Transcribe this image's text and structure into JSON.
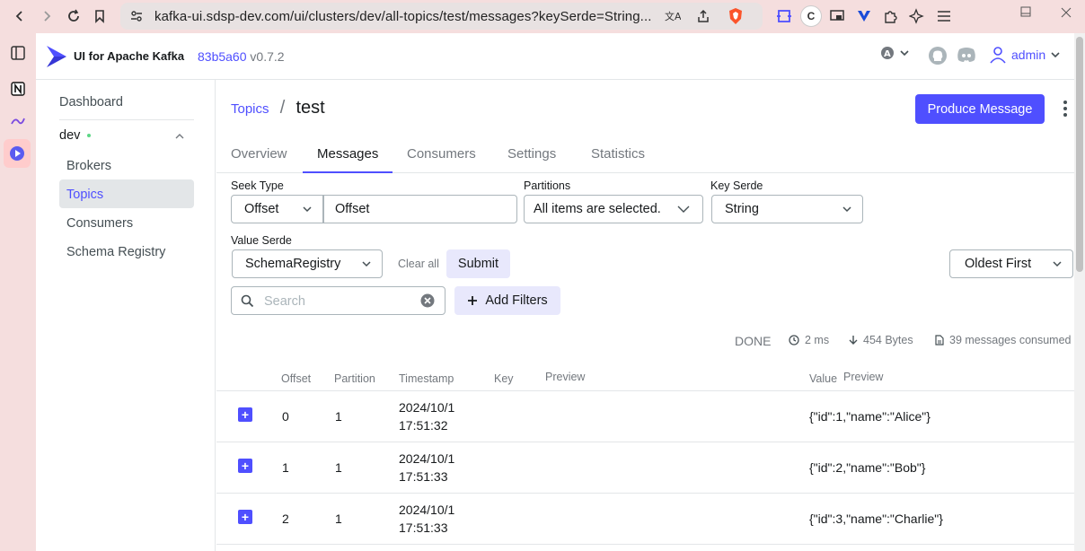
{
  "browser": {
    "url": "kafka-ui.sdsp-dev.com/ui/clusters/dev/all-topics/test/messages?keySerde=String..."
  },
  "header": {
    "brand": "UI for Apache Kafka",
    "version_hash": "83b5a60",
    "version": "v0.7.2",
    "user": "admin"
  },
  "nav": {
    "dashboard": "Dashboard",
    "cluster": "dev",
    "items": [
      "Brokers",
      "Topics",
      "Consumers",
      "Schema Registry"
    ]
  },
  "page": {
    "breadcrumb_link": "Topics",
    "title": "test",
    "produce_button": "Produce Message"
  },
  "tabs": [
    "Overview",
    "Messages",
    "Consumers",
    "Settings",
    "Statistics"
  ],
  "filters": {
    "seek_type_label": "Seek Type",
    "seek_type_value": "Offset",
    "offset_value": "Offset",
    "partitions_label": "Partitions",
    "partitions_value": "All items are selected.",
    "key_serde_label": "Key Serde",
    "key_serde_value": "String",
    "value_serde_label": "Value Serde",
    "value_serde_value": "SchemaRegistry",
    "clear_all": "Clear all",
    "submit": "Submit",
    "sort": "Oldest First",
    "search_placeholder": "Search",
    "add_filters": "Add Filters"
  },
  "stats": {
    "status": "DONE",
    "elapsed": "2 ms",
    "bytes": "454 Bytes",
    "consumed": "39 messages consumed"
  },
  "table": {
    "headers": {
      "offset": "Offset",
      "partition": "Partition",
      "timestamp": "Timestamp",
      "key": "Key",
      "key_preview": "Preview",
      "value": "Value",
      "value_preview": "Preview"
    },
    "rows": [
      {
        "offset": "0",
        "partition": "1",
        "date": "2024/10/1",
        "time": "17:51:32",
        "value": "{\"id\":1,\"name\":\"Alice\"}"
      },
      {
        "offset": "1",
        "partition": "1",
        "date": "2024/10/1",
        "time": "17:51:33",
        "value": "{\"id\":2,\"name\":\"Bob\"}"
      },
      {
        "offset": "2",
        "partition": "1",
        "date": "2024/10/1",
        "time": "17:51:33",
        "value": "{\"id\":3,\"name\":\"Charlie\"}"
      }
    ]
  },
  "colors": {
    "accent": "#4f4fff",
    "browser_chrome": "#f5dede"
  }
}
